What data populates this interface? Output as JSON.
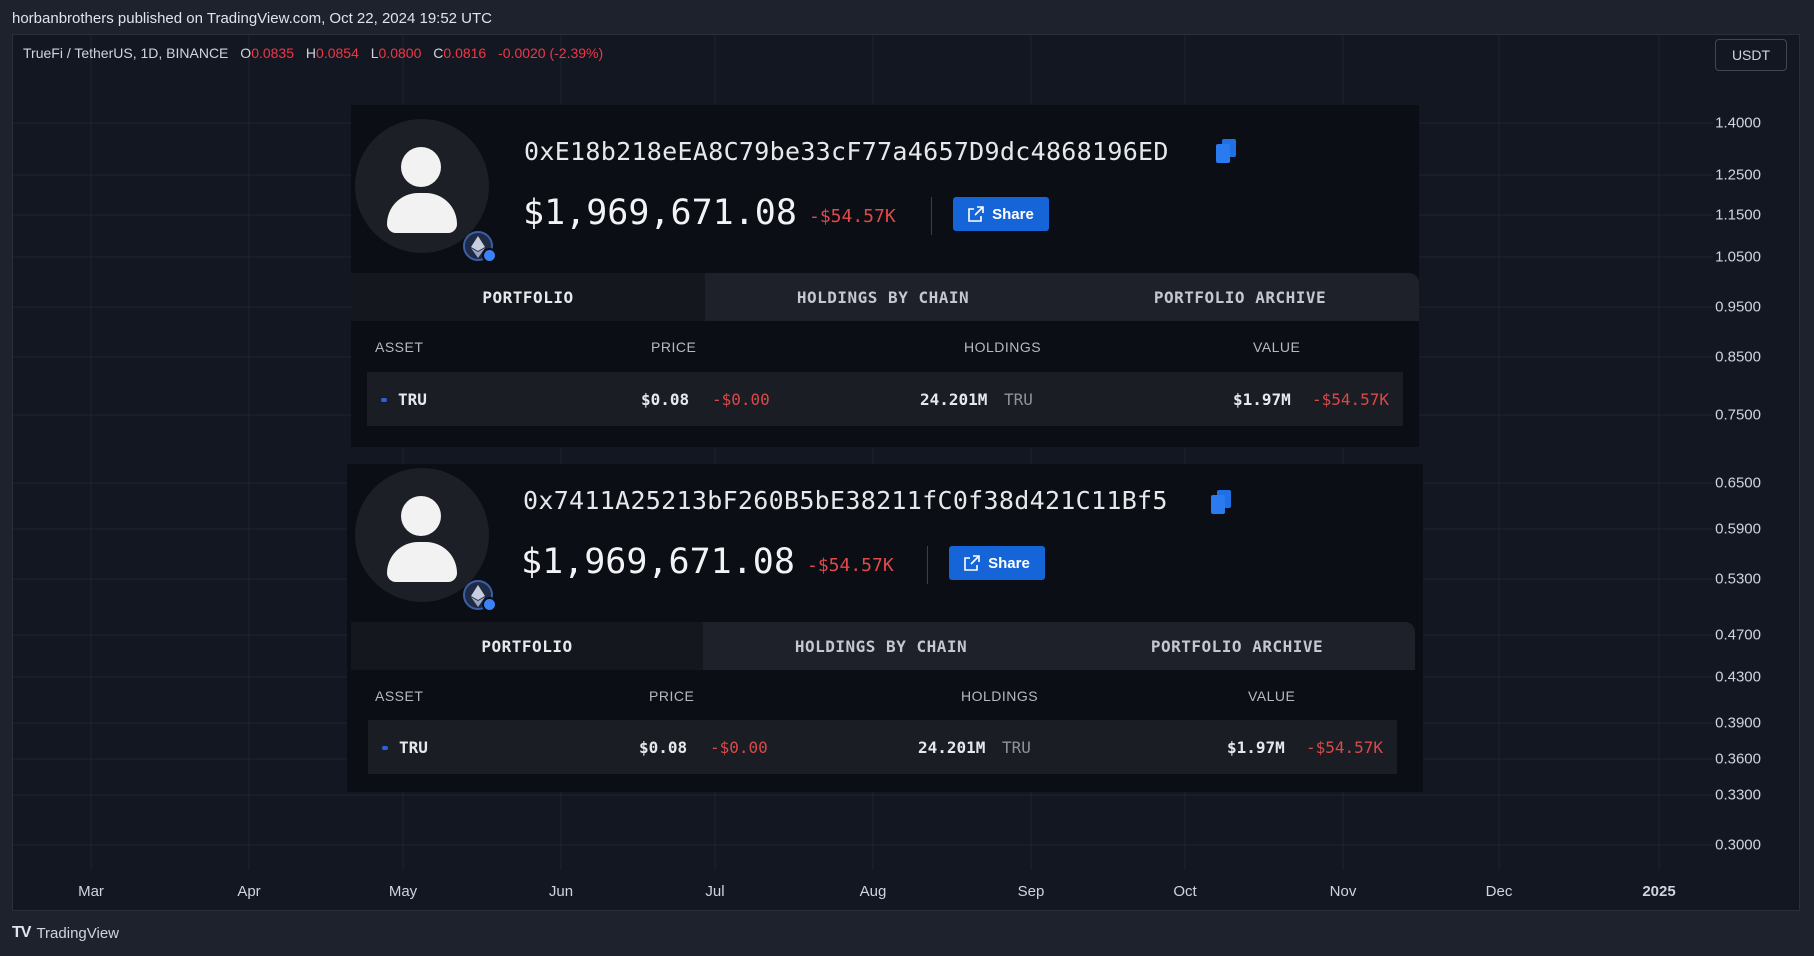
{
  "header": {
    "published": "horbanbrothers published on TradingView.com, Oct 22, 2024 19:52 UTC"
  },
  "chart": {
    "symbol": "TrueFi / TetherUS, 1D, BINANCE",
    "ohlc": {
      "o_label": "O",
      "o": "0.0835",
      "h_label": "H",
      "h": "0.0854",
      "l_label": "L",
      "l": "0.0800",
      "c_label": "C",
      "c": "0.0816",
      "change": "-0.0020 (-2.39%)"
    },
    "currency": "USDT",
    "price_scale": [
      "1.4000",
      "1.2500",
      "1.1500",
      "1.0500",
      "0.9500",
      "0.8500",
      "0.7500",
      "0.6500",
      "0.5900",
      "0.5300",
      "0.4700",
      "0.4300",
      "0.3900",
      "0.3600",
      "0.3300",
      "0.3000"
    ],
    "time_scale": [
      "Mar",
      "Apr",
      "May",
      "Jun",
      "Jul",
      "Aug",
      "Sep",
      "Oct",
      "Nov",
      "Dec",
      "2025"
    ],
    "colors": {
      "background": "#131722",
      "grid": "#1f2330",
      "down": "#f23645"
    }
  },
  "cards": [
    {
      "address": "0xE18b218eEA8C79be33cF77a4657D9dc4868196ED",
      "balance": "$1,969,671.08",
      "change": "-$54.57K",
      "share_label": "Share",
      "tabs": [
        "PORTFOLIO",
        "HOLDINGS BY CHAIN",
        "PORTFOLIO ARCHIVE"
      ],
      "columns": [
        "ASSET",
        "PRICE",
        "HOLDINGS",
        "VALUE"
      ],
      "row": {
        "asset": "TRU",
        "price": "$0.08",
        "price_change": "-$0.00",
        "holdings": "24.201M",
        "holdings_unit": "TRU",
        "value": "$1.97M",
        "value_change": "-$54.57K"
      }
    },
    {
      "address": "0x7411A25213bF260B5bE38211fC0f38d421C11Bf5",
      "balance": "$1,969,671.08",
      "change": "-$54.57K",
      "share_label": "Share",
      "tabs": [
        "PORTFOLIO",
        "HOLDINGS BY CHAIN",
        "PORTFOLIO ARCHIVE"
      ],
      "columns": [
        "ASSET",
        "PRICE",
        "HOLDINGS",
        "VALUE"
      ],
      "row": {
        "asset": "TRU",
        "price": "$0.08",
        "price_change": "-$0.00",
        "holdings": "24.201M",
        "holdings_unit": "TRU",
        "value": "$1.97M",
        "value_change": "-$54.57K"
      }
    }
  ],
  "footer": {
    "brand": "TradingView",
    "logo": "TV"
  },
  "icons": {
    "copy": "copy-icon",
    "share": "external-link-icon",
    "avatar": "user-avatar-icon",
    "eth": "ethereum-icon"
  }
}
